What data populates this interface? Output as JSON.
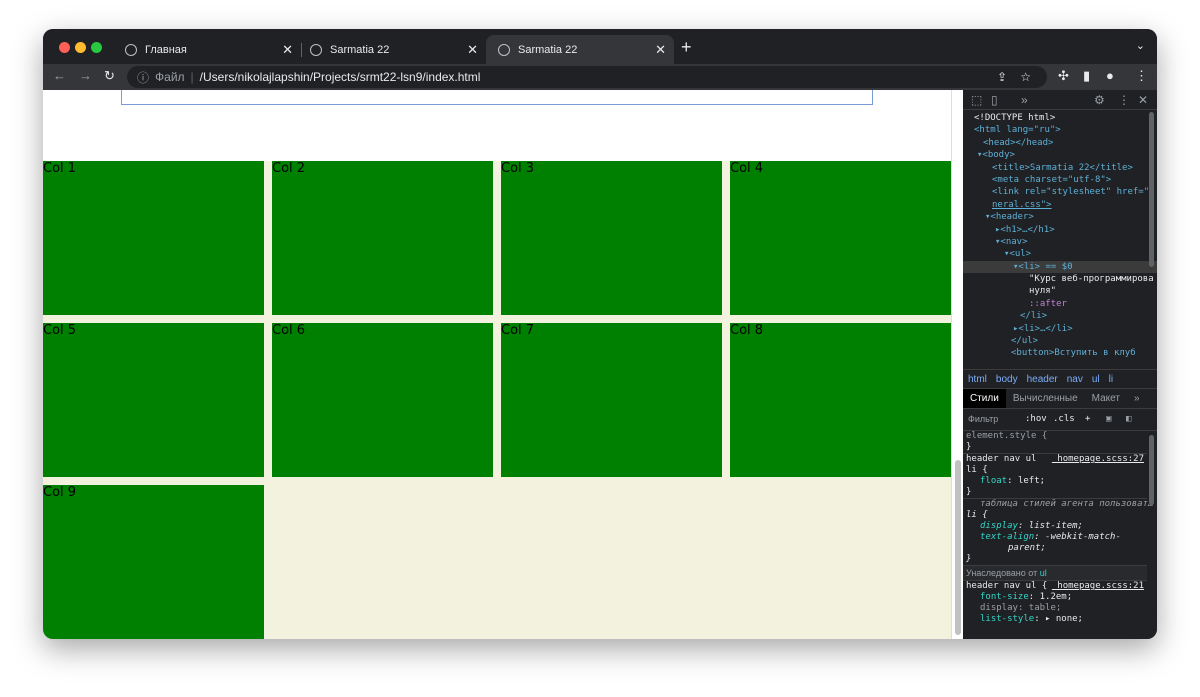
{
  "browser": {
    "tabs": [
      {
        "title": "Главная",
        "active": false
      },
      {
        "title": "Sarmatia 22",
        "active": false
      },
      {
        "title": "Sarmatia 22",
        "active": true
      }
    ],
    "address": {
      "scheme_label": "Файл",
      "url": "/Users/nikolajlapshin/Projects/srmt22-lsn9/index.html"
    }
  },
  "page": {
    "columns": [
      "Col 1",
      "Col 2",
      "Col 3",
      "Col 4",
      "Col 5",
      "Col 6",
      "Col 7",
      "Col 8",
      "Col 9"
    ],
    "colors": {
      "column": "#008000",
      "background": "#f3f2df"
    }
  },
  "devtools": {
    "dom_lines": [
      "<!DOCTYPE html>",
      "<html lang=\"ru\">",
      "<head></head>",
      "<body>",
      "<title>Sarmatia 22</title>",
      "<meta charset=\"utf-8\">",
      "<link rel=\"stylesheet\" href=\"g",
      "neral.css\">",
      "<header>",
      "<h1>…</h1>",
      "<nav>",
      "<ul>",
      "<li> == $0",
      "\"Курс веб-программирова",
      "нуля\"",
      "::after",
      "</li>",
      "<li>…</li>",
      "</ul>",
      "<button>Вступить в клуб"
    ],
    "breadcrumbs": [
      "html",
      "body",
      "header",
      "nav",
      "ul",
      "li"
    ],
    "style_tabs": [
      "Стили",
      "Вычисленные",
      "Макет",
      "»"
    ],
    "filter": {
      "placeholder": "Фильтр",
      "hov": ":hov",
      "cls": ".cls"
    },
    "rules": {
      "element_style": "element.style {",
      "close": "}",
      "r1_sel": "header nav ul",
      "r1_sel2": "li {",
      "r1_src": "_homepage.scss:27",
      "r1_prop": "float",
      "r1_val": "left;",
      "r2_header": "таблица стилей агента пользоват…",
      "r2_sel": "li {",
      "r2_p1": "display",
      "r2_v1": "list-item;",
      "r2_p2": "text-align",
      "r2_v2": "-webkit-match-",
      "r2_v2b": "parent;",
      "inherited_label": "Унаследовано от",
      "inherited_from": "ul",
      "r3_sel": "header nav ul {",
      "r3_src": "_homepage.scss:21",
      "r3_p1": "font-size",
      "r3_v1": "1.2em;",
      "r3_p2": "display",
      "r3_v2": "table;",
      "r3_p3": "list-style",
      "r3_v3": "▸ none;"
    }
  }
}
